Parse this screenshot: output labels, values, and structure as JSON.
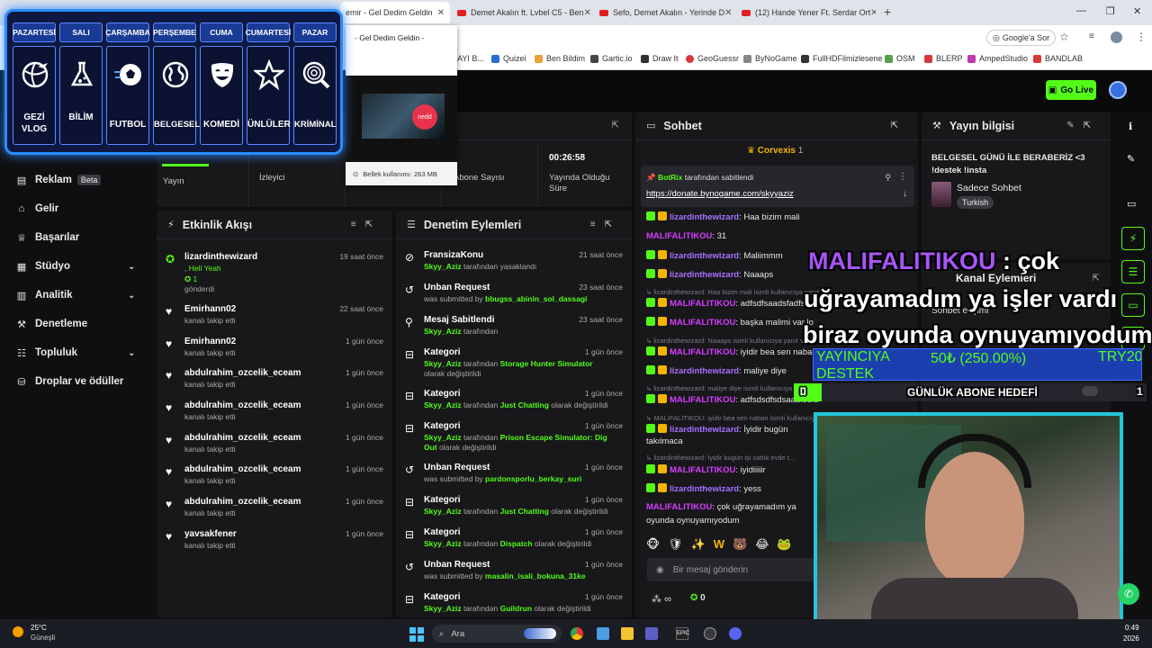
{
  "browser": {
    "tabs": [
      {
        "title": "emir - Gel Dedim Geldin",
        "active": true
      },
      {
        "title": "Demet Akalın ft. Lvbel C5 - Ben"
      },
      {
        "title": "Sefo, Demet Akalın - Yerinde D"
      },
      {
        "title": "(12) Hande Yener Ft. Serdar Ort"
      }
    ],
    "new_tab": "+",
    "tab_preview": {
      "title": "- Gel Dedim Geldin -",
      "memory": "Bellek kullanımı: 263 MB",
      "logo": "nedd"
    },
    "address": {
      "google_btn": "Google'a Sor"
    },
    "bookmarks": [
      "AYI B...",
      "Quizei",
      "Ben Bildim",
      "Gartic.io",
      "Draw It",
      "GeoGuessr",
      "ByNoGame",
      "FullHDFilmizlesene",
      "OSM",
      "BLERP",
      "AmpedStudio",
      "BANDLAB"
    ]
  },
  "header": {
    "go_live": "Go Live"
  },
  "sidebar": {
    "items": [
      {
        "label": "Reklam",
        "badge": "Beta",
        "icon": "document-icon"
      },
      {
        "label": "Gelir",
        "icon": "bank-icon"
      },
      {
        "label": "Başarılar",
        "icon": "trophy-icon"
      },
      {
        "label": "Stüdyo",
        "icon": "studio-icon",
        "chevron": true
      },
      {
        "label": "Analitik",
        "icon": "chart-icon",
        "chevron": true
      },
      {
        "label": "Denetleme",
        "icon": "wrench-icon"
      },
      {
        "label": "Topluluk",
        "icon": "community-icon",
        "chevron": true
      },
      {
        "label": "Droplar ve ödüller",
        "icon": "gift-icon"
      }
    ]
  },
  "stats": [
    {
      "value": "",
      "label": "Yayın"
    },
    {
      "value": "",
      "label": "İzleyici"
    },
    {
      "value": "",
      "label": "Abone Sayısı"
    },
    {
      "value": "00:26:58",
      "label": "Yayında Olduğu Süre"
    }
  ],
  "activity": {
    "title": "Etkinlik Akışı",
    "items": [
      {
        "name": "lizardinthewizard",
        "sub": ", Hell Yeah",
        "extra": "1",
        "extra2": "gönderdi",
        "time": "19 saat önce",
        "icon": "kick-icon"
      },
      {
        "name": "Emirhann02",
        "sub": "kanalı takip etti",
        "time": "22 saat önce",
        "icon": "heart-icon"
      },
      {
        "name": "Emirhann02",
        "sub": "kanalı takip etti",
        "time": "1 gün önce",
        "icon": "heart-icon"
      },
      {
        "name": "abdulrahim_ozcelik_eceam",
        "sub": "kanalı takip etti",
        "time": "1 gün önce",
        "icon": "heart-icon"
      },
      {
        "name": "abdulrahim_ozcelik_eceam",
        "sub": "kanalı takip etti",
        "time": "1 gün önce",
        "icon": "heart-icon"
      },
      {
        "name": "abdulrahim_ozcelik_eceam",
        "sub": "kanalı takip etti",
        "time": "1 gün önce",
        "icon": "heart-icon"
      },
      {
        "name": "abdulrahim_ozcelik_eceam",
        "sub": "kanalı takip etti",
        "time": "1 gün önce",
        "icon": "heart-icon"
      },
      {
        "name": "abdulrahim_ozcelik_eceam",
        "sub": "kanalı takip etti",
        "time": "1 gün önce",
        "icon": "heart-icon"
      },
      {
        "name": "yavsakfener",
        "sub": "kanalı takip etti",
        "time": "1 gün önce",
        "icon": "heart-icon"
      }
    ]
  },
  "moderation": {
    "title": "Denetim Eylemleri",
    "items": [
      {
        "title": "FransizaKonu",
        "a": "Skyy_Aziz",
        "b": " tarafından yasaklandı",
        "c": "",
        "time": "21 saat önce",
        "icon": "ban-icon"
      },
      {
        "title": "Unban Request",
        "a": "was submitted by ",
        "b": "bbugss_abinin_sol_dassagi",
        "c": "",
        "time": "23 saat önce",
        "icon": "unban-icon"
      },
      {
        "title": "Mesaj Sabitlendi",
        "a": "Skyy_Aziz",
        "b": " tarafından",
        "c": "",
        "time": "23 saat önce",
        "icon": "pin-icon"
      },
      {
        "title": "Kategori",
        "a": "Skyy_Aziz",
        "b": " tarafından ",
        "c": "Storage Hunter Simulator",
        "d": " olarak değiştirildi",
        "time": "1 gün önce",
        "icon": "category-icon"
      },
      {
        "title": "Kategori",
        "a": "Skyy_Aziz",
        "b": " tarafından ",
        "c": "Just Chatting",
        "d": " olarak değiştirildi",
        "time": "1 gün önce",
        "icon": "category-icon"
      },
      {
        "title": "Kategori",
        "a": "Skyy_Aziz",
        "b": " tarafından ",
        "c": "Prison Escape Simulator: Dig Out",
        "d": " olarak değiştirildi",
        "time": "1 gün önce",
        "icon": "category-icon"
      },
      {
        "title": "Unban Request",
        "a": "was submitted by ",
        "b": "pardonsporlu_berkay_suri",
        "c": "",
        "time": "1 gün önce",
        "icon": "unban-icon"
      },
      {
        "title": "Kategori",
        "a": "Skyy_Aziz",
        "b": " tarafından ",
        "c": "Just Chatting",
        "d": " olarak değiştirildi",
        "time": "1 gün önce",
        "icon": "category-icon"
      },
      {
        "title": "Kategori",
        "a": "Skyy_Aziz",
        "b": " tarafından ",
        "c": "Dispatch",
        "d": " olarak değiştirildi",
        "time": "1 gün önce",
        "icon": "category-icon"
      },
      {
        "title": "Unban Request",
        "a": "was submitted by ",
        "b": "masalin_isali_bokuna_31ke",
        "c": "",
        "time": "1 gün önce",
        "icon": "unban-icon"
      },
      {
        "title": "Kategori",
        "a": "Skyy_Aziz",
        "b": " tarafından ",
        "c": "Guildrun",
        "d": " olarak değiştirildi",
        "time": "1 gün önce",
        "icon": "category-icon"
      }
    ]
  },
  "chat": {
    "title": "Sohbet",
    "top_user": "Corvexis",
    "top_count": "1",
    "pinned": {
      "by": "BotRix",
      "note": "tarafından sabitlendi",
      "link": "https://donate.bynogame.com/skyyaziz"
    },
    "messages": [
      {
        "user": "lizardinthewizard",
        "text": ": Haa bizim mali",
        "color": "#a970ff"
      },
      {
        "user": "MALIFALITIKOU",
        "text": ": 31",
        "color": "#d53cff"
      },
      {
        "user": "lizardinthewizard",
        "text": ": Maliimmm",
        "color": "#a970ff"
      },
      {
        "user": "lizardinthewizard",
        "text": ": Naaaps",
        "color": "#a970ff"
      },
      {
        "reply": "lizardinthewizard: Haa bizim mali isimli kullanıcıya yanıt veri..."
      },
      {
        "user": "MALIFALITIKOU",
        "text": ": adfsdfsaadsfadfsc",
        "color": "#d53cff"
      },
      {
        "user": "MALIFALITIKOU",
        "text": ": başka malimi var lo",
        "color": "#d53cff"
      },
      {
        "reply": "lizardinthewizard: Naaaps isimli kullanıcıya yanıt veri..."
      },
      {
        "user": "MALIFALITIKOU",
        "text": ": iyidir bea sen naban",
        "color": "#d53cff"
      },
      {
        "user": "lizardinthewizard",
        "text": ": maliye diye",
        "color": "#a970ff"
      },
      {
        "reply": "lizardinthewizard: maliye diye isimli kullanıcıya yanıt veri..."
      },
      {
        "user": "MALIFALITIKOU",
        "text": ": adfsdsdfsdsaadfsdfs",
        "color": "#d53cff"
      },
      {
        "reply": "MALIFALITIKOU: iyidir bea sen naban isimli kullanıcıya..."
      },
      {
        "user": "lizardinthewizard",
        "text": ": İyidir bugün",
        "color": "#a970ff"
      },
      {
        "plain": "takılmaca"
      },
      {
        "reply": "lizardinthewizard: İyidir bugün işi sattık evde t..."
      },
      {
        "user": "MALIFALITIKOU",
        "text": ": iyidiiiiir",
        "color": "#d53cff"
      },
      {
        "user": "lizardinthewizard",
        "text": ": yess",
        "color": "#a970ff"
      },
      {
        "user": "MALIFALITIKOU",
        "text": ": çok uğrayamadım ya",
        "color": "#d53cff"
      },
      {
        "plain": "oyunda oynuyamıyodum"
      }
    ],
    "emotes": [
      "🐵",
      "🛡",
      "✨",
      "W",
      "🐻",
      "😂",
      "🐸"
    ],
    "input_placeholder": "Bir mesaj gönderin",
    "footer_left": "∞",
    "footer_right": "0"
  },
  "stream_info": {
    "title": "Yayın bilgisi",
    "stream_title": "BELGESEL GÜNÜ İLE BERABERİZ <3 !destek !insta",
    "category": "Sadece Sohbet",
    "tag": "Turkish"
  },
  "channel_actions": {
    "title": "Kanal Eylemleri",
    "sub": "Sohbet erişimi"
  },
  "overlay": {
    "chat_user": "MALIFALITIKOU",
    "chat_sep": " : çok",
    "chat_line2": "uğrayamadım ya işler vardı",
    "chat_line3": "biraz oyunda oynuyamıyodum",
    "ticker_left": "YAYINCIYA",
    "ticker_mid": "50₺ (250.00%)",
    "ticker_right": "TRY20",
    "ticker_line2": "DESTEK",
    "goal_label": "GÜNLÜK ABONE HEDEFİ",
    "goal_left": "0",
    "goal_right": "1",
    "goal_progress": 0.08
  },
  "schedule": {
    "days": [
      {
        "day": "PAZARTESİ",
        "label": "GEZİ VLOG",
        "icon": "globe-plane-icon"
      },
      {
        "day": "SALI",
        "label": "BİLİM",
        "icon": "flask-icon"
      },
      {
        "day": "ÇARŞAMBA",
        "label": "FUTBOL",
        "icon": "soccer-ball-icon"
      },
      {
        "day": "PERŞEMBE",
        "label": "BELGESEL",
        "icon": "globe-icon"
      },
      {
        "day": "CUMA",
        "label": "KOMEDİ",
        "icon": "comedy-mask-icon"
      },
      {
        "day": "CUMARTESİ",
        "label": "ÜNLÜLER",
        "icon": "star-icon"
      },
      {
        "day": "PAZAR",
        "label": "KRİMİNAL",
        "icon": "fingerprint-icon"
      }
    ]
  },
  "taskbar": {
    "weather_temp": "25°C",
    "weather_desc": "Güneşli",
    "search": "Ara",
    "clock_time": "0:49",
    "clock_date": "2026"
  },
  "colors": {
    "accent": "#53fc18",
    "panel": "#18181b",
    "background": "#0f0f11",
    "schedule_border": "#2b8bff",
    "overlay_name": "#a855f7"
  }
}
